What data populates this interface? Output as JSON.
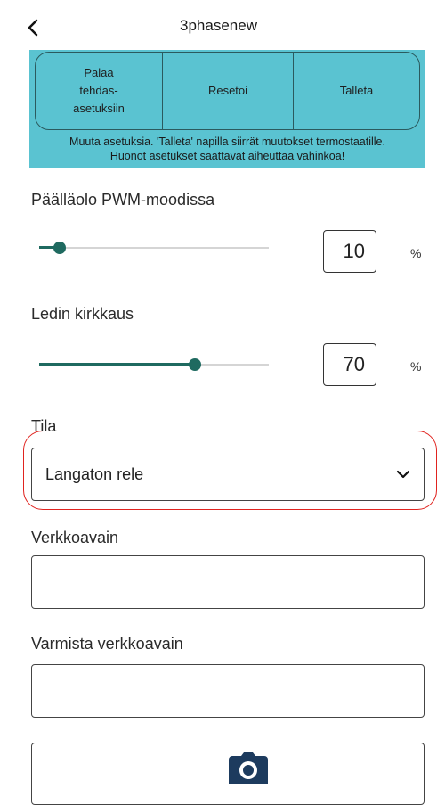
{
  "header": {
    "title": "3phasenew",
    "back_icon": "chevron-left-icon"
  },
  "action_panel": {
    "buttons": [
      {
        "line1": "Palaa",
        "line2": "tehdas-",
        "line3": "asetuksiin"
      },
      {
        "label": "Resetoi"
      },
      {
        "label": "Talleta"
      }
    ],
    "warning_line1": "Muuta asetuksia. 'Talleta' napilla siirrät muutokset termostaatille.",
    "warning_line2": "Huonot asetukset saattavat aiheuttaa vahinkoa!",
    "background_color": "#5ac3d1"
  },
  "pwm": {
    "label": "Päälläolo PWM-moodissa",
    "value": "10",
    "unit": "%",
    "slider_fraction": 0.09
  },
  "led": {
    "label": "Ledin kirkkaus",
    "value": "70",
    "unit": "%",
    "slider_fraction": 0.68
  },
  "mode": {
    "label": "Tila",
    "selected": "Langaton rele",
    "chevron_icon": "chevron-down-icon"
  },
  "network_key": {
    "label": "Verkkoavain",
    "value": ""
  },
  "confirm_key": {
    "label": "Varmista verkkoavain",
    "value": ""
  },
  "camera": {
    "icon": "camera-icon"
  },
  "colors": {
    "accent": "#1f6a60",
    "highlight": "#e0231f",
    "camera": "#1d3b5e"
  }
}
